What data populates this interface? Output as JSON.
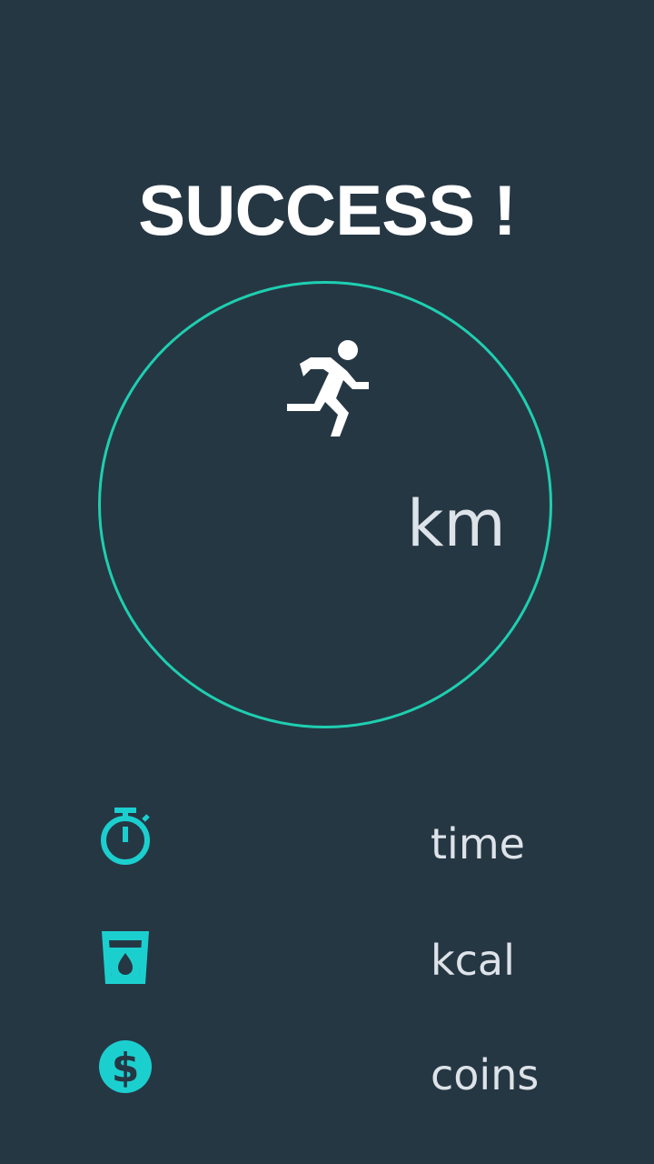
{
  "header": {
    "title": "SUCCESS !"
  },
  "summary": {
    "distance_unit": "km",
    "activity_icon": "running-person-icon"
  },
  "stats": [
    {
      "icon": "stopwatch-icon",
      "label": "time"
    },
    {
      "icon": "water-cup-icon",
      "label": "kcal"
    },
    {
      "icon": "dollar-coin-icon",
      "label": "coins"
    }
  ],
  "colors": {
    "background": "#263744",
    "accent": "#1ecfb0",
    "icon": "#1ccfcf",
    "text": "#dde3e8",
    "title": "#ffffff"
  }
}
